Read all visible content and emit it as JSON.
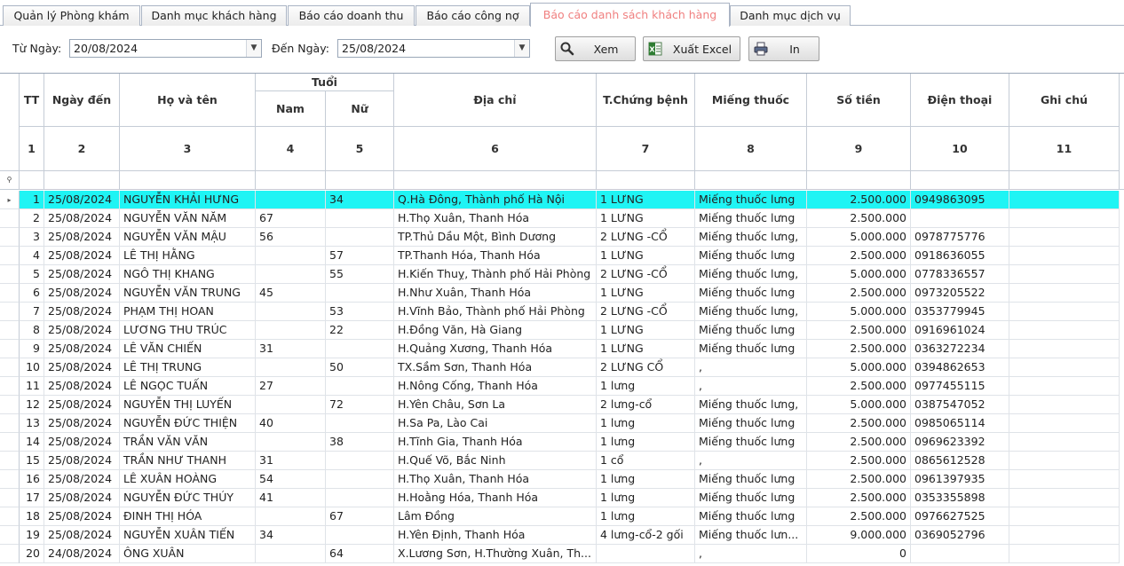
{
  "tabs": [
    {
      "label": "Quản lý Phòng khám",
      "active": false
    },
    {
      "label": "Danh mục khách hàng",
      "active": false
    },
    {
      "label": "Báo cáo doanh thu",
      "active": false
    },
    {
      "label": "Báo cáo công nợ",
      "active": false
    },
    {
      "label": "Báo cáo danh sách khách hàng",
      "active": true
    },
    {
      "label": "Danh mục dịch vụ",
      "active": false
    }
  ],
  "filter": {
    "from_label": "Từ Ngày:",
    "from_value": "20/08/2024",
    "to_label": "Đến Ngày:",
    "to_value": "25/08/2024",
    "view_button": "Xem",
    "excel_button": "Xuất Excel",
    "print_button": "In"
  },
  "grid": {
    "headers": {
      "tt": "TT",
      "date": "Ngày đến",
      "name": "Họ và tên",
      "age": "Tuổi",
      "male": "Nam",
      "female": "Nữ",
      "address": "Địa chỉ",
      "symptom": "T.Chứng bệnh",
      "patch": "Miếng thuốc",
      "amount": "Số tiền",
      "phone": "Điện thoại",
      "note": "Ghi chú"
    },
    "col_numbers": [
      "1",
      "2",
      "3",
      "4",
      "5",
      "6",
      "7",
      "8",
      "9",
      "10",
      "11"
    ],
    "rows": [
      {
        "tt": "1",
        "date": "25/08/2024",
        "name": "NGUYỄN KHẢI HƯNG",
        "male": "",
        "female": "34",
        "address": "Q.Hà Đông, Thành phố Hà Nội",
        "symptom": "1 LƯNG",
        "patch": "Miếng thuốc lưng",
        "amount": "2.500.000",
        "phone": "0949863095",
        "note": "",
        "selected": true
      },
      {
        "tt": "2",
        "date": "25/08/2024",
        "name": "NGUYỄN VĂN NĂM",
        "male": "67",
        "female": "",
        "address": "H.Thọ Xuân, Thanh Hóa",
        "symptom": "1 LƯNG",
        "patch": "Miếng thuốc lưng",
        "amount": "2.500.000",
        "phone": "",
        "note": ""
      },
      {
        "tt": "3",
        "date": "25/08/2024",
        "name": "NGUYỄN VĂN MẬU",
        "male": "56",
        "female": "",
        "address": "TP.Thủ Dầu Một, Bình Dương",
        "symptom": "2 LƯNG -CỔ",
        "patch": "Miếng thuốc lưng,",
        "amount": "5.000.000",
        "phone": "0978775776",
        "note": ""
      },
      {
        "tt": "4",
        "date": "25/08/2024",
        "name": "LÊ THỊ HẰNG",
        "male": "",
        "female": "57",
        "address": "TP.Thanh Hóa, Thanh Hóa",
        "symptom": "1 LƯNG",
        "patch": "Miếng thuốc lưng",
        "amount": "2.500.000",
        "phone": "0918636055",
        "note": ""
      },
      {
        "tt": "5",
        "date": "25/08/2024",
        "name": "NGÔ THỊ KHANG",
        "male": "",
        "female": "55",
        "address": "H.Kiến Thuỵ, Thành phố Hải Phòng",
        "symptom": "2 LƯNG -CỔ",
        "patch": "Miếng thuốc lưng,",
        "amount": "5.000.000",
        "phone": "0778336557",
        "note": ""
      },
      {
        "tt": "6",
        "date": "25/08/2024",
        "name": "NGUYỄN VĂN TRUNG",
        "male": "45",
        "female": "",
        "address": "H.Như Xuân, Thanh Hóa",
        "symptom": "1 LƯNG",
        "patch": "Miếng thuốc lưng",
        "amount": "2.500.000",
        "phone": "0973205522",
        "note": ""
      },
      {
        "tt": "7",
        "date": "25/08/2024",
        "name": "PHẠM THỊ HOAN",
        "male": "",
        "female": "53",
        "address": "H.Vĩnh Bảo, Thành phố Hải Phòng",
        "symptom": "2 LƯNG -CỔ",
        "patch": "Miếng thuốc lưng,",
        "amount": "5.000.000",
        "phone": "0353779945",
        "note": ""
      },
      {
        "tt": "8",
        "date": "25/08/2024",
        "name": "LƯƠNG THU TRÚC",
        "male": "",
        "female": "22",
        "address": "H.Đồng Văn, Hà Giang",
        "symptom": "1 LƯNG",
        "patch": "Miếng thuốc lưng",
        "amount": "2.500.000",
        "phone": "0916961024",
        "note": ""
      },
      {
        "tt": "9",
        "date": "25/08/2024",
        "name": "LÊ VĂN CHIẾN",
        "male": "31",
        "female": "",
        "address": "H.Quảng Xương, Thanh Hóa",
        "symptom": "1 LƯNG",
        "patch": "Miếng thuốc lưng",
        "amount": "2.500.000",
        "phone": "0363272234",
        "note": ""
      },
      {
        "tt": "10",
        "date": "25/08/2024",
        "name": "LÊ THỊ TRUNG",
        "male": "",
        "female": "50",
        "address": "TX.Sầm Sơn, Thanh Hóa",
        "symptom": "2 LƯNG CỔ",
        "patch": ",",
        "amount": "5.000.000",
        "phone": "0394862653",
        "note": ""
      },
      {
        "tt": "11",
        "date": "25/08/2024",
        "name": "LÊ NGỌC TUẤN",
        "male": "27",
        "female": "",
        "address": "H.Nông Cống, Thanh Hóa",
        "symptom": "1 lưng",
        "patch": ",",
        "amount": "2.500.000",
        "phone": "0977455115",
        "note": ""
      },
      {
        "tt": "12",
        "date": "25/08/2024",
        "name": "NGUYỄN THỊ LUYẾN",
        "male": "",
        "female": "72",
        "address": "H.Yên Châu, Sơn La",
        "symptom": "2 lưng-cổ",
        "patch": "Miếng thuốc lưng,",
        "amount": "5.000.000",
        "phone": "0387547052",
        "note": ""
      },
      {
        "tt": "13",
        "date": "25/08/2024",
        "name": "NGUYỄN ĐỨC THIỆN",
        "male": "40",
        "female": "",
        "address": "H.Sa Pa, Lào Cai",
        "symptom": "1 lưng",
        "patch": "Miếng thuốc lưng",
        "amount": "2.500.000",
        "phone": "0985065114",
        "note": ""
      },
      {
        "tt": "14",
        "date": "25/08/2024",
        "name": "TRẦN VĂN VĂN",
        "male": "",
        "female": "38",
        "address": "H.Tĩnh Gia, Thanh Hóa",
        "symptom": "1 lưng",
        "patch": "Miếng thuốc lưng",
        "amount": "2.500.000",
        "phone": "0969623392",
        "note": ""
      },
      {
        "tt": "15",
        "date": "25/08/2024",
        "name": "TRẦN NHƯ THANH",
        "male": "31",
        "female": "",
        "address": "H.Quế Võ, Bắc Ninh",
        "symptom": "1 cổ",
        "patch": ",",
        "amount": "2.500.000",
        "phone": "0865612528",
        "note": ""
      },
      {
        "tt": "16",
        "date": "25/08/2024",
        "name": "LÊ XUÂN HOÀNG",
        "male": "54",
        "female": "",
        "address": "H.Thọ Xuân, Thanh Hóa",
        "symptom": "1 lưng",
        "patch": "Miếng thuốc lưng",
        "amount": "2.500.000",
        "phone": "0961397935",
        "note": ""
      },
      {
        "tt": "17",
        "date": "25/08/2024",
        "name": "NGUYỄN ĐỨC THÚY",
        "male": "41",
        "female": "",
        "address": "H.Hoằng Hóa, Thanh Hóa",
        "symptom": "1 lưng",
        "patch": "Miếng thuốc lưng",
        "amount": "2.500.000",
        "phone": "0353355898",
        "note": ""
      },
      {
        "tt": "18",
        "date": "25/08/2024",
        "name": "ĐINH THỊ HÓA",
        "male": "",
        "female": "67",
        "address": "Lâm Đồng",
        "symptom": "1 lưng",
        "patch": "Miếng thuốc lưng",
        "amount": "2.500.000",
        "phone": "0976627525",
        "note": ""
      },
      {
        "tt": "19",
        "date": "25/08/2024",
        "name": "NGUYỄN XUÂN TIẾN",
        "male": "34",
        "female": "",
        "address": "H.Yên Định, Thanh Hóa",
        "symptom": "4 lưng-cổ-2 gối",
        "patch": "Miếng thuốc lưn...",
        "amount": "9.000.000",
        "phone": "0369052796",
        "note": ""
      },
      {
        "tt": "20",
        "date": "24/08/2024",
        "name": "ÔNG XUÂN",
        "male": "",
        "female": "64",
        "address": "X.Lương Sơn, H.Thường Xuân, Th...",
        "symptom": "",
        "patch": ",",
        "amount": "0",
        "phone": "",
        "note": ""
      }
    ]
  },
  "colors": {
    "selected_row": "#1ff4f4",
    "active_tab_text": "#f08080"
  },
  "icons": {
    "view": "search-icon",
    "excel": "excel-icon",
    "print": "printer-icon",
    "filter_row": "filter-icon",
    "current_row": "row-pointer-icon"
  }
}
